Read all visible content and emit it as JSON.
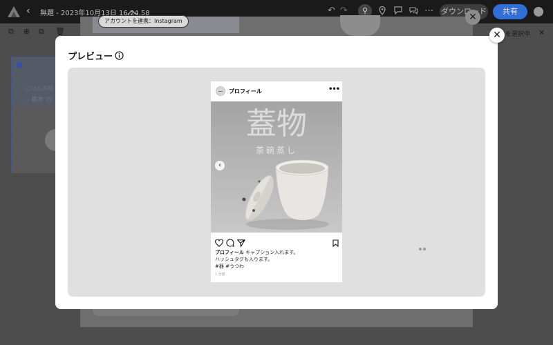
{
  "app": {
    "document_title": "無題 - 2023年10月13日 16.24.58",
    "download_label": "ダウンロード",
    "share_label": "共有",
    "page_select_label": "ジを選択中"
  },
  "background": {
    "connect_label": "アカウントを連携：Instagram",
    "thumb_text_1": "ごはんの時",
    "thumb_text_2": "- 基本 の"
  },
  "modal": {
    "title": "プレビュー"
  },
  "instagram_post": {
    "username": "プロフィール",
    "headline": "蓋物",
    "subtitle": "茶碗蒸し",
    "caption_username": "プロフィール",
    "caption_text": "キャプション入れます。",
    "caption_line2": "ハッシュタグも入ります。",
    "hashtags": "#器 #うつわ",
    "time": "1 分前"
  },
  "icons": {
    "info": "info-icon",
    "close": "close-icon",
    "heart": "heart-icon",
    "comment": "comment-icon",
    "share": "send-icon",
    "bookmark": "bookmark-icon"
  },
  "colors": {
    "share_button": "#2f6fd6",
    "preview_background": "#e0e0e0",
    "overlay": "#4d4d4d"
  }
}
